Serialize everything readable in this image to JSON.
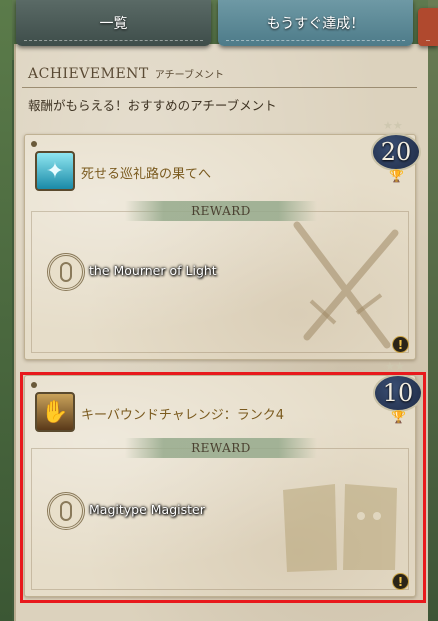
{
  "tabs": {
    "list_label": "一覧",
    "soon_label": "もうすぐ達成！"
  },
  "header": {
    "title": "ACHIEVEMENT",
    "subtitle": "アチーブメント"
  },
  "section": {
    "description": "報酬がもらえる！おすすめのアチーブメント"
  },
  "cards": [
    {
      "title": "死せる巡礼路の果てへ",
      "reward_label": "REWARD",
      "reward_name": "the Mourner of Light",
      "points": "20",
      "icon": "achievement-light-icon"
    },
    {
      "title": "キーバウンドチャレンジ：ランク4",
      "reward_label": "REWARD",
      "reward_name": "Magitype Magister",
      "points": "10",
      "icon": "achievement-key-icon"
    }
  ],
  "colors": {
    "highlight": "#e8191c",
    "card_title": "#7a5a1e",
    "badge": "#1e2a44"
  }
}
